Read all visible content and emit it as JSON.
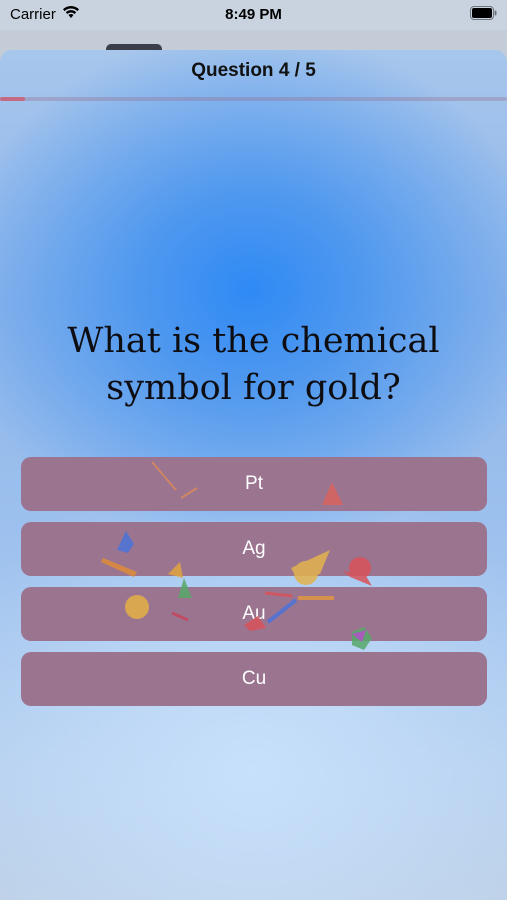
{
  "status_bar": {
    "carrier": "Carrier",
    "time": "8:49 PM"
  },
  "quiz": {
    "title": "Question 4 / 5",
    "progress": 0.05,
    "question": "What is the chemical symbol for gold?",
    "options": [
      "Pt",
      "Ag",
      "Au",
      "Cu"
    ]
  },
  "colors": {
    "option_background": "#9b7490",
    "progress_fill": "#c46a82",
    "accent_blue": "#2f8af5"
  },
  "icons": [
    "wifi-icon",
    "battery-icon",
    "confetti"
  ]
}
